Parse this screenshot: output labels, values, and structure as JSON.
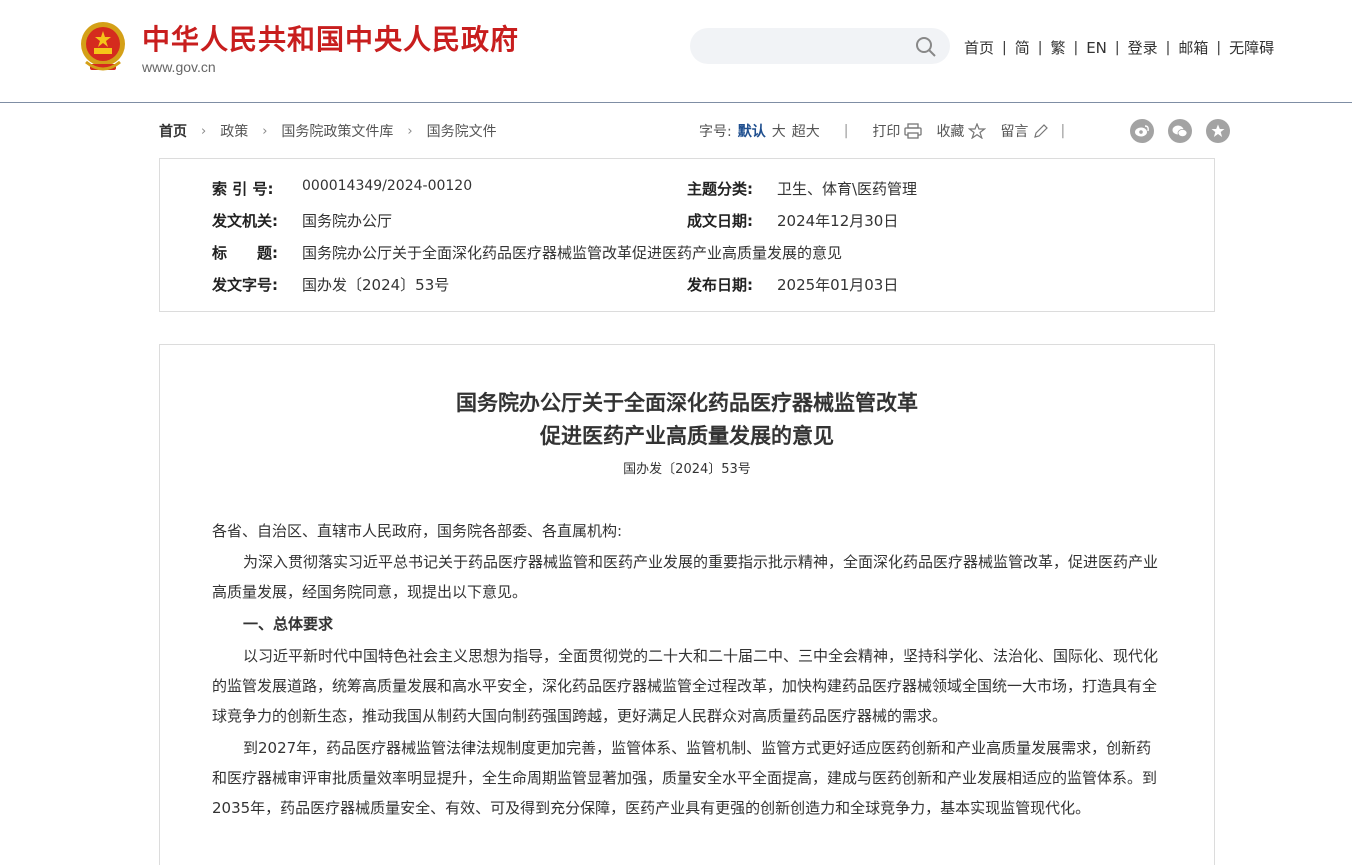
{
  "site": {
    "title": "中华人民共和国中央人民政府",
    "url": "www.gov.cn"
  },
  "search": {
    "placeholder": ""
  },
  "topnav": {
    "items": [
      "首页",
      "简",
      "繁",
      "EN",
      "登录",
      "邮箱",
      "无障碍"
    ],
    "separator": "|"
  },
  "breadcrumb": {
    "items": [
      "首页",
      "政策",
      "国务院政策文件库",
      "国务院文件"
    ],
    "arrow": "›"
  },
  "tools": {
    "font_label": "字号:",
    "font_sizes": [
      "默认",
      "大",
      "超大"
    ],
    "divider": "|",
    "print": "打印",
    "favorite": "收藏",
    "comment": "留言"
  },
  "meta": {
    "index_label": "索 引 号:",
    "index_value": "000014349/2024-00120",
    "topic_label": "主题分类:",
    "topic_value": "卫生、体育\\医药管理",
    "issuer_label": "发文机关:",
    "issuer_value": "国务院办公厅",
    "date_written_label": "成文日期:",
    "date_written_value": "2024年12月30日",
    "title_label": "标　　题:",
    "title_value": "国务院办公厅关于全面深化药品医疗器械监管改革促进医药产业高质量发展的意见",
    "doc_no_label": "发文字号:",
    "doc_no_value": "国办发〔2024〕53号",
    "publish_label": "发布日期:",
    "publish_value": "2025年01月03日"
  },
  "article": {
    "title_line1": "国务院办公厅关于全面深化药品医疗器械监管改革",
    "title_line2": "促进医药产业高质量发展的意见",
    "doc_number": "国办发〔2024〕53号",
    "salutation": "各省、自治区、直辖市人民政府，国务院各部委、各直属机构:",
    "p1": "为深入贯彻落实习近平总书记关于药品医疗器械监管和医药产业发展的重要指示批示精神，全面深化药品医疗器械监管改革，促进医药产业高质量发展，经国务院同意，现提出以下意见。",
    "section1": "一、总体要求",
    "p2": "以习近平新时代中国特色社会主义思想为指导，全面贯彻党的二十大和二十届二中、三中全会精神，坚持科学化、法治化、国际化、现代化的监管发展道路，统筹高质量发展和高水平安全，深化药品医疗器械监管全过程改革，加快构建药品医疗器械领域全国统一大市场，打造具有全球竞争力的创新生态，推动我国从制药大国向制药强国跨越，更好满足人民群众对高质量药品医疗器械的需求。",
    "p3": "到2027年，药品医疗器械监管法律法规制度更加完善，监管体系、监管机制、监管方式更好适应医药创新和产业高质量发展需求，创新药和医疗器械审评审批质量效率明显提升，全生命周期监管显著加强，质量安全水平全面提高，建成与医药创新和产业发展相适应的监管体系。到2035年，药品医疗器械质量安全、有效、可及得到充分保障，医药产业具有更强的创新创造力和全球竞争力，基本实现监管现代化。"
  },
  "colors": {
    "brand_red": "#c81e1e",
    "link_blue": "#1f4f8f",
    "border": "#dcdcdc"
  }
}
